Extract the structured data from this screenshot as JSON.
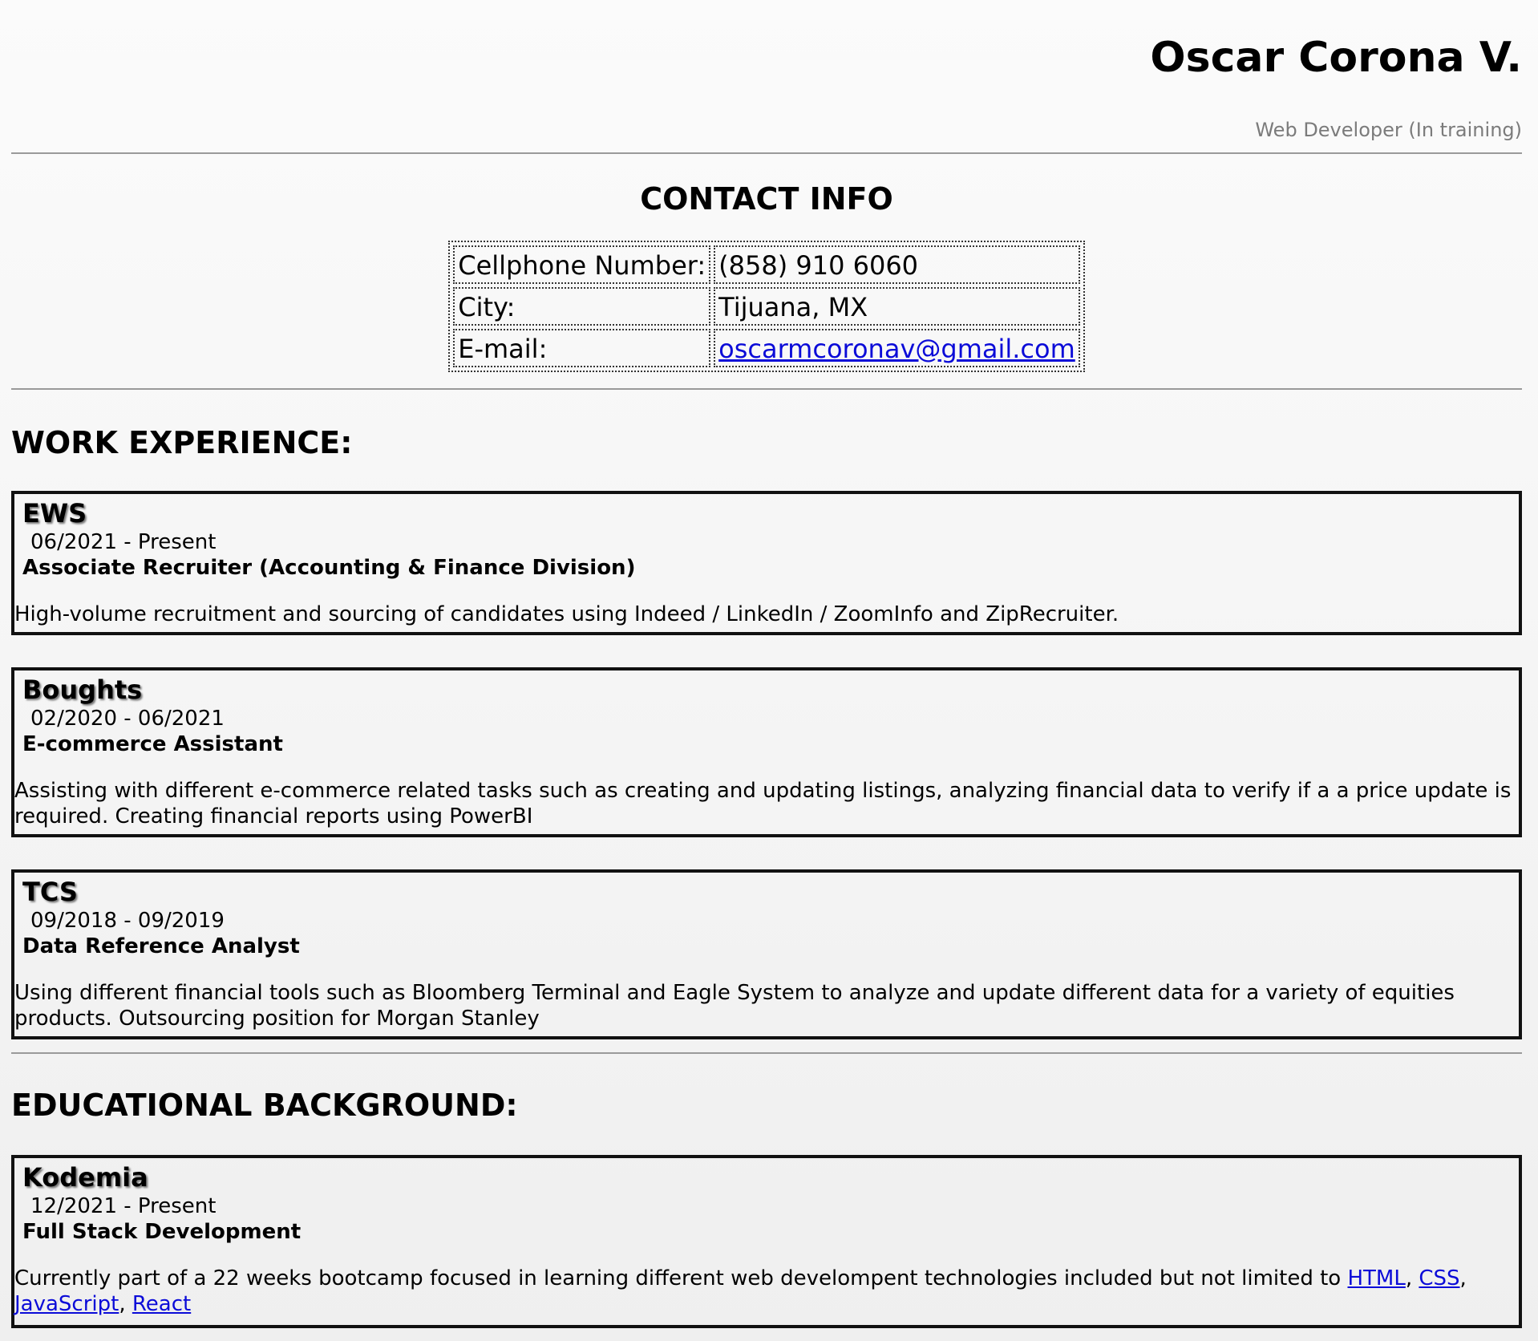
{
  "header": {
    "name": "Oscar Corona V.",
    "role": "Web Developer (In training)"
  },
  "contact": {
    "title": "CONTACT INFO",
    "rows": [
      {
        "label": "Cellphone Number:",
        "value": "(858) 910 6060"
      },
      {
        "label": "City:",
        "value": "Tijuana, MX"
      },
      {
        "label": "E-mail:",
        "value": "oscarmcoronav@gmail.com"
      }
    ]
  },
  "work": {
    "title": "WORK EXPERIENCE:",
    "items": [
      {
        "company": "EWS",
        "dates": "06/2021 - Present",
        "position": "Associate Recruiter (Accounting & Finance Division)",
        "description": "High-volume recruitment and sourcing of candidates using Indeed / LinkedIn / ZoomInfo and ZipRecruiter."
      },
      {
        "company": "Boughts",
        "dates": "02/2020 - 06/2021",
        "position": "E-commerce Assistant",
        "description": "Assisting with different e-commerce related tasks such as creating and updating listings, analyzing financial data to verify if a a price update is required. Creating financial reports using PowerBI"
      },
      {
        "company": "TCS",
        "dates": "09/2018 - 09/2019",
        "position": "Data Reference Analyst",
        "description": "Using different financial tools such as Bloomberg Terminal and Eagle System to analyze and update different data for a variety of equities products. Outsourcing position for Morgan Stanley"
      }
    ]
  },
  "education": {
    "title": "EDUCATIONAL BACKGROUND:",
    "items": [
      {
        "company": "Kodemia",
        "dates": "12/2021 - Present",
        "position": "Full Stack Development",
        "description": "Currently part of a 22 weeks bootcamp focused in learning different web develompent technologies included but not limited to",
        "links": [
          "HTML",
          "CSS",
          "JavaScript",
          "React"
        ],
        "separator": ", "
      }
    ]
  },
  "colors": {
    "link": "#0b0bd8",
    "role_text": "#7b7b7b",
    "card_border": "#111111"
  }
}
